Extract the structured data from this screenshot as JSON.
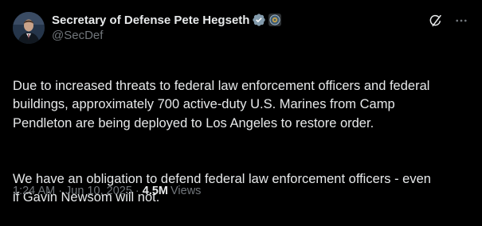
{
  "tweet": {
    "author": {
      "display_name": "Secretary of Defense Pete Hegseth",
      "handle": "@SecDef",
      "verified_icon": "verified-checkmark-icon",
      "affiliation_icon": "government-seal-icon"
    },
    "paragraphs": [
      "Due to increased threats to federal law enforcement officers and federal\nbuildings, approximately 700 active-duty U.S. Marines from Camp\nPendleton are being deployed to Los Angeles to restore order.",
      "We have an obligation to defend federal law enforcement officers - even\nif Gavin Newsom will not."
    ],
    "meta": {
      "time": "1:24 AM",
      "separator": "·",
      "date": "Jun 10, 2025",
      "separator2": "·",
      "views_count": "4.5M",
      "views_label": "Views"
    },
    "actions": {
      "grok_icon": "grok-icon",
      "more_icon": "more-icon"
    }
  },
  "colors": {
    "background": "#000000",
    "text_primary": "#e7e9ea",
    "text_secondary": "#71767b",
    "verified_badge": "#829aab"
  }
}
